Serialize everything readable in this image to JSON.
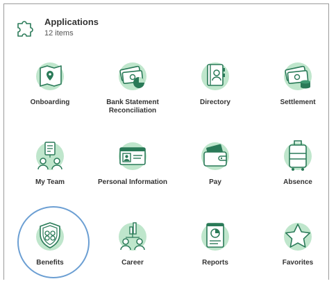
{
  "header": {
    "title": "Applications",
    "count": "12 items",
    "icon": "puzzle-icon"
  },
  "apps": [
    {
      "label": "Onboarding",
      "icon": "map-pin-icon"
    },
    {
      "label": "Bank Statement Reconciliation",
      "icon": "money-pie-icon"
    },
    {
      "label": "Directory",
      "icon": "address-book-icon"
    },
    {
      "label": "Settlement",
      "icon": "money-coins-icon"
    },
    {
      "label": "My Team",
      "icon": "team-icon"
    },
    {
      "label": "Personal Information",
      "icon": "id-card-icon"
    },
    {
      "label": "Pay",
      "icon": "wallet-icon"
    },
    {
      "label": "Absence",
      "icon": "suitcase-icon"
    },
    {
      "label": "Benefits",
      "icon": "shield-icon"
    },
    {
      "label": "Career",
      "icon": "career-icon"
    },
    {
      "label": "Reports",
      "icon": "report-icon"
    },
    {
      "label": "Favorites",
      "icon": "star-icon"
    }
  ],
  "colors": {
    "accent_green": "#2a7a58",
    "light_green": "#bfe6cc",
    "highlight_ring": "#6c9fd3"
  }
}
